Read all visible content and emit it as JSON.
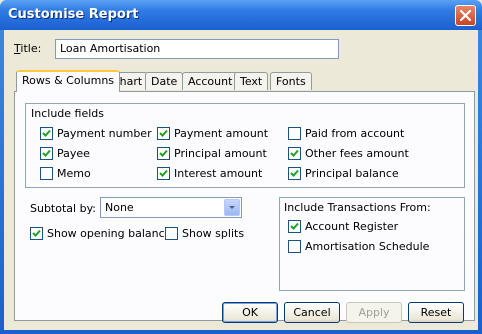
{
  "window": {
    "title": "Customise Report"
  },
  "title_field": {
    "label": "Title:",
    "value": "Loan Amortisation"
  },
  "tabs": [
    {
      "label": "Rows & Columns",
      "active": true
    },
    {
      "label": "Chart"
    },
    {
      "label": "Date"
    },
    {
      "label": "Account"
    },
    {
      "label": "Text"
    },
    {
      "label": "Fonts"
    }
  ],
  "include_fields": {
    "group_label": "Include fields",
    "items": [
      {
        "label": "Payment number",
        "checked": true
      },
      {
        "label": "Payee",
        "checked": true
      },
      {
        "label": "Memo",
        "checked": false
      },
      {
        "label": "Payment amount",
        "checked": true
      },
      {
        "label": "Principal amount",
        "checked": true
      },
      {
        "label": "Interest amount",
        "checked": true
      },
      {
        "label": "Paid from account",
        "checked": false
      },
      {
        "label": "Other fees amount",
        "checked": true
      },
      {
        "label": "Principal balance",
        "checked": true
      }
    ]
  },
  "subtotal": {
    "label": "Subtotal by:",
    "value": "None"
  },
  "options": {
    "show_opening_balance": {
      "label": "Show opening balance",
      "checked": true
    },
    "show_splits": {
      "label": "Show splits",
      "checked": false
    }
  },
  "include_transactions": {
    "group_label": "Include Transactions From:",
    "account_register": {
      "label": "Account Register",
      "checked": true
    },
    "amortisation_schedule": {
      "label": "Amortisation Schedule",
      "checked": false
    }
  },
  "buttons": {
    "ok": "OK",
    "cancel": "Cancel",
    "apply": "Apply",
    "reset": "Reset"
  }
}
